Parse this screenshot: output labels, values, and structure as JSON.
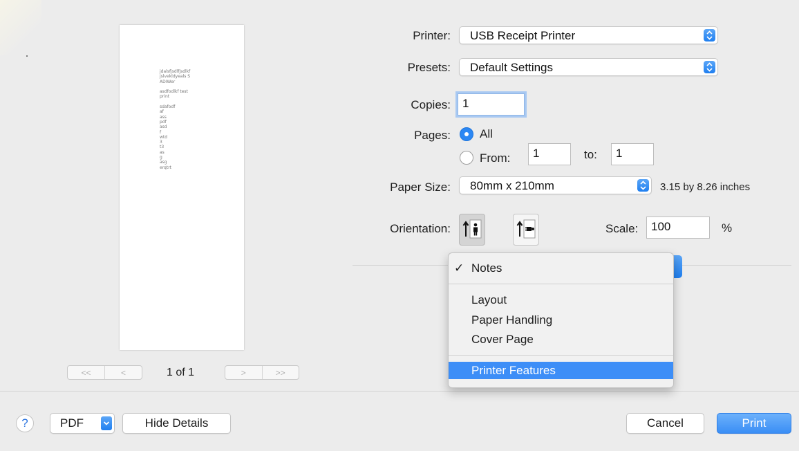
{
  "preview": {
    "lines": [
      "jdalsfjsdlfjsdlkf",
      "jslvekldyeals S",
      "ADIWer",
      "",
      "asdfodlkf test",
      "print",
      "",
      "sdafodf",
      "af",
      "ass",
      "pdf",
      "asd",
      "f",
      "wtd",
      "3",
      "t3",
      "as",
      "g",
      "asg",
      "erqtrt"
    ],
    "first_label": "<<",
    "prev_label": "<",
    "next_label": ">",
    "last_label": ">>",
    "page_count": "1 of 1"
  },
  "printer": {
    "label": "Printer:",
    "value": "USB Receipt Printer"
  },
  "presets": {
    "label": "Presets:",
    "value": "Default Settings"
  },
  "copies": {
    "label": "Copies:",
    "value": "1"
  },
  "pages": {
    "label": "Pages:",
    "all_label": "All",
    "from_label": "From:",
    "from_value": "1",
    "to_label": "to:",
    "to_value": "1"
  },
  "paper_size": {
    "label": "Paper Size:",
    "value": "80mm x 210mm",
    "dimensions": "3.15 by 8.26 inches"
  },
  "orientation": {
    "label": "Orientation:"
  },
  "scale": {
    "label": "Scale:",
    "value": "100",
    "unit": "%"
  },
  "menu": {
    "checkmark": "✓",
    "items": [
      "Notes",
      "Layout",
      "Paper Handling",
      "Cover Page",
      "Printer Features"
    ],
    "checked": "Notes",
    "highlighted": "Printer Features"
  },
  "bottom": {
    "help_label": "?",
    "pdf_label": "PDF",
    "hide_details_label": "Hide Details",
    "cancel_label": "Cancel",
    "print_label": "Print"
  },
  "colors": {
    "accent": "#3d8ef7",
    "background": "#ececec"
  }
}
